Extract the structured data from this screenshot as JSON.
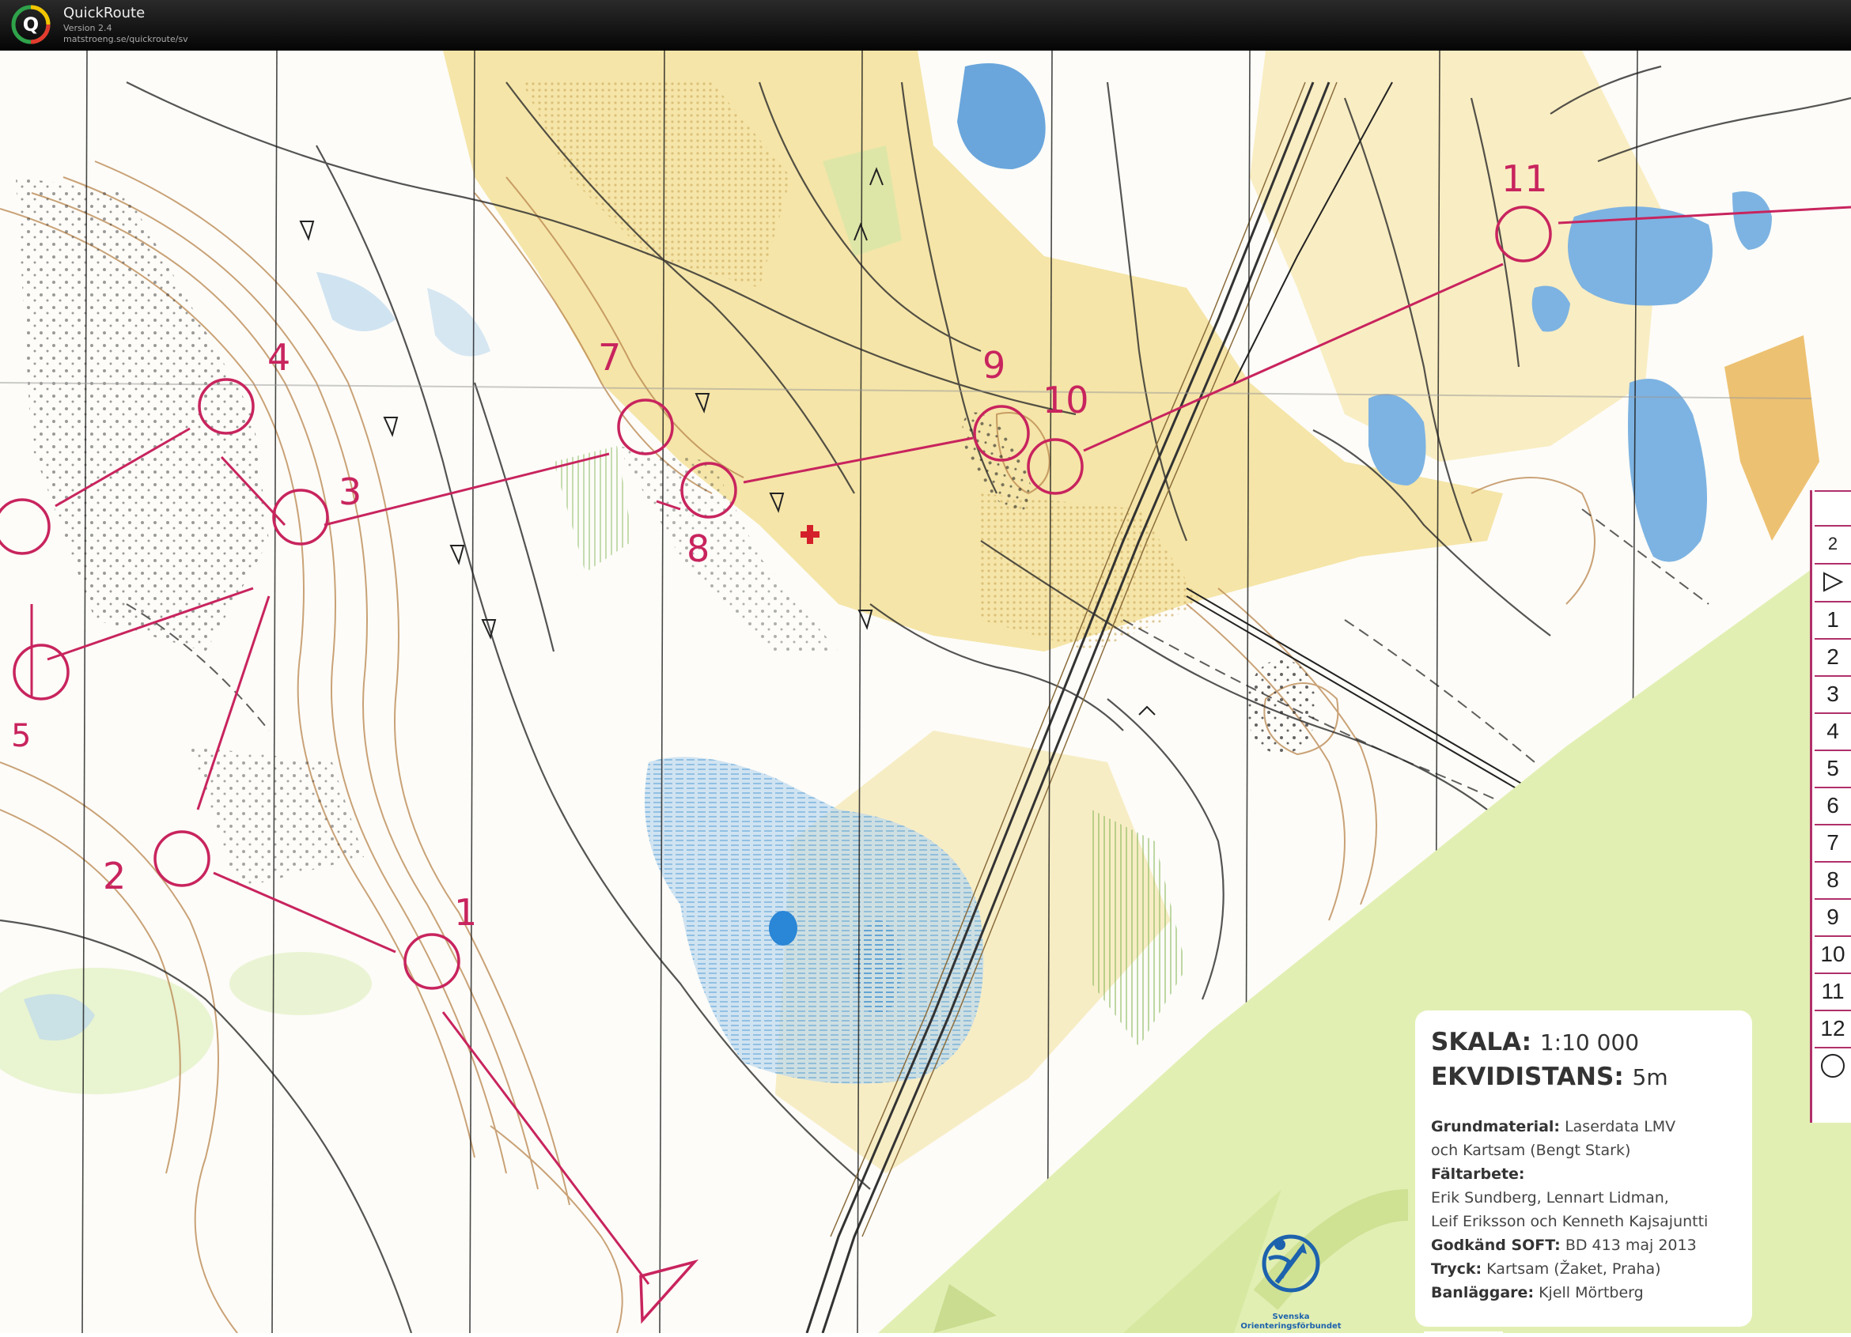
{
  "app": {
    "title": "QuickRoute",
    "version": "Version 2.4",
    "url": "matstroeng.se/quickroute/sv"
  },
  "map": {
    "controls": [
      {
        "label": "1"
      },
      {
        "label": "2"
      },
      {
        "label": "3"
      },
      {
        "label": "4"
      },
      {
        "label": "7"
      },
      {
        "label": "8"
      },
      {
        "label": "9"
      },
      {
        "label": "10"
      },
      {
        "label": "11"
      }
    ],
    "colors": {
      "course": "#c8245e",
      "yellow_open": "#f3e09a",
      "water": "#9fc6e6",
      "green_light": "#d8ecb0",
      "contour": "#b8844c"
    }
  },
  "description_sheet": {
    "rows": [
      "2",
      "1",
      "2",
      "3",
      "4",
      "5",
      "6",
      "7",
      "8",
      "9",
      "10",
      "11",
      "12"
    ]
  },
  "info": {
    "scale_label": "SKALA:",
    "scale_value": "1:10 000",
    "contour_label": "EKVIDISTANS:",
    "contour_value": "5m",
    "lines": [
      {
        "label": "Grundmaterial:",
        "text": "Laserdata LMV"
      },
      {
        "label": "",
        "text": "och Kartsam (Bengt Stark)"
      },
      {
        "label": "Fältarbete:",
        "text": ""
      },
      {
        "label": "",
        "text": "Erik Sundberg, Lennart Lidman,"
      },
      {
        "label": "",
        "text": "Leif Eriksson och Kenneth Kajsajuntti"
      },
      {
        "label": "Godkänd SOFT:",
        "text": "BD 413 maj 2013"
      },
      {
        "label": "Tryck:",
        "text": "Kartsam (Žaket, Praha)"
      },
      {
        "label": "Banläggare:",
        "text": "Kjell Mörtberg"
      }
    ],
    "federation_name_1": "Svenska",
    "federation_name_2": "Orienteringsförbundet"
  }
}
